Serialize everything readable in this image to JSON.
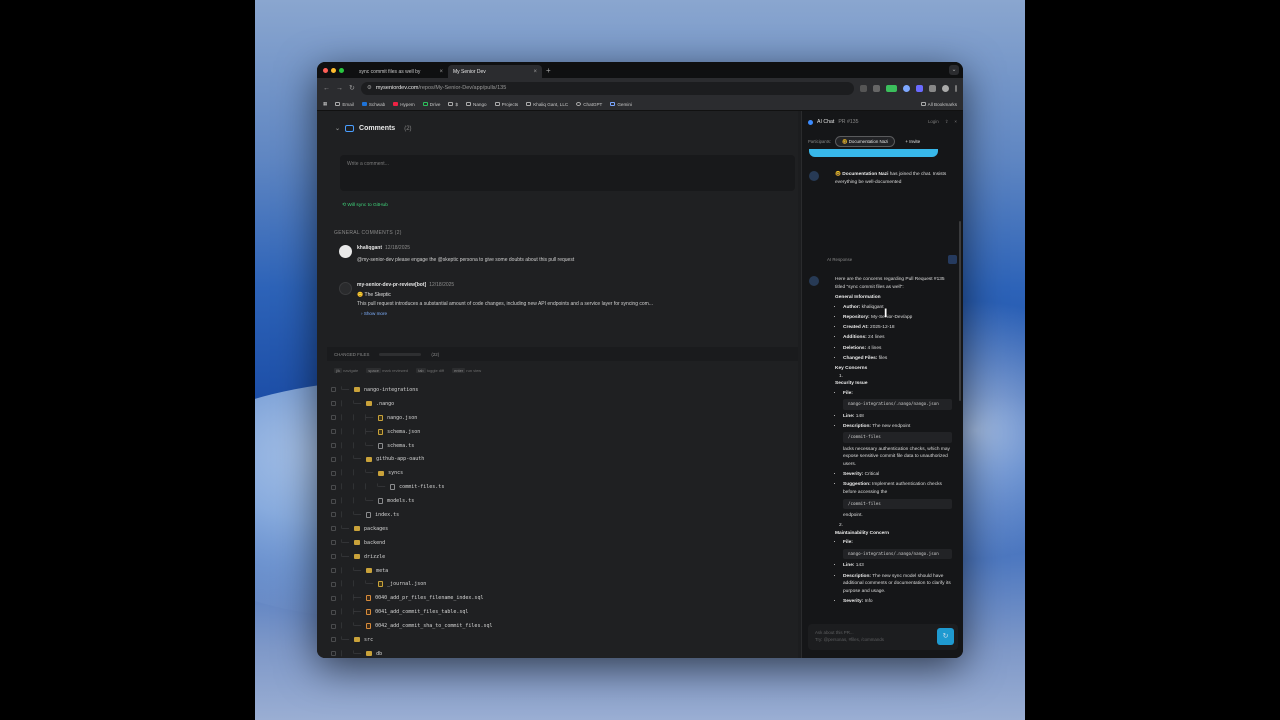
{
  "browser": {
    "tabs": [
      {
        "label": "sync commit files as well by",
        "active": false
      },
      {
        "label": "My Senior Dev",
        "active": true
      }
    ],
    "new_tab": "+",
    "url_host": "myseniordev.com",
    "url_path": "/repos/My-Senior-Dev/app/pulls/135",
    "bookmarks": [
      "Email",
      "Schwab",
      "Hypem",
      "Drive",
      "$",
      "Nango",
      "Projects",
      "Khaliq Gant, LLC",
      "ChatGPT",
      "Gemini"
    ],
    "all_bookmarks": "All Bookmarks"
  },
  "comments": {
    "title": "Comments",
    "count": "(2)",
    "placeholder": "Write a comment...",
    "sync_note": "Will sync to GitHub",
    "general_header": "GENERAL COMMENTS (2)",
    "items": [
      {
        "author": "khaliqgant",
        "date": "12/18/2025",
        "body": "@my-senior-dev please engage the @skeptic persona to give some doubts about this pull request"
      },
      {
        "author": "my-senior-dev-pr-review[bot]",
        "date": "12/18/2025",
        "persona": "😊 The Skeptic",
        "body": "This pull request introduces a substantial amount of code changes, including new API endpoints and a service layer for syncing com...",
        "more": "Show more"
      }
    ]
  },
  "changed_files": {
    "label": "CHANGED FILES",
    "count": "(22)",
    "hints": [
      {
        "key": "j/k",
        "text": "navigate"
      },
      {
        "key": "space",
        "text": "mark reviewed"
      },
      {
        "key": "tab",
        "text": "toggle diff"
      },
      {
        "key": "enter",
        "text": "run view"
      }
    ],
    "tree": [
      {
        "indent": "└── ",
        "name": "nango-integrations",
        "type": "folder"
      },
      {
        "indent": "│   └── ",
        "name": ".nango",
        "type": "folder"
      },
      {
        "indent": "│   │   ├── ",
        "name": "nango.json",
        "type": "json"
      },
      {
        "indent": "│   │   ├── ",
        "name": "schema.json",
        "type": "json"
      },
      {
        "indent": "│   │   └── ",
        "name": "schema.ts",
        "type": "file"
      },
      {
        "indent": "│   └── ",
        "name": "github-app-oauth",
        "type": "folder"
      },
      {
        "indent": "│   │   └── ",
        "name": "syncs",
        "type": "folder"
      },
      {
        "indent": "│   │   │   └── ",
        "name": "commit-files.ts",
        "type": "file"
      },
      {
        "indent": "│   │   └── ",
        "name": "models.ts",
        "type": "file"
      },
      {
        "indent": "│   └── ",
        "name": "index.ts",
        "type": "file"
      },
      {
        "indent": "└── ",
        "name": "packages",
        "type": "folder"
      },
      {
        "indent": "└── ",
        "name": "backend",
        "type": "folder"
      },
      {
        "indent": "└── ",
        "name": "drizzle",
        "type": "folder"
      },
      {
        "indent": "│   └── ",
        "name": "meta",
        "type": "folder"
      },
      {
        "indent": "│   │   └── ",
        "name": "_journal.json",
        "type": "json"
      },
      {
        "indent": "│   ├── ",
        "name": "0040_add_pr_files_filename_index.sql",
        "type": "sql"
      },
      {
        "indent": "│   ├── ",
        "name": "0041_add_commit_files_table.sql",
        "type": "sql"
      },
      {
        "indent": "│   └── ",
        "name": "0042_add_commit_sha_to_commit_files.sql",
        "type": "sql"
      },
      {
        "indent": "└── ",
        "name": "src",
        "type": "folder"
      },
      {
        "indent": "│   └── ",
        "name": "db",
        "type": "folder"
      }
    ]
  },
  "ai_chat": {
    "title": "AI Chat",
    "pr": "PR #135",
    "login": "Login",
    "participants_label": "Participants:",
    "participant": "🤓 Documentation Nazi",
    "invite": "+ Invite",
    "system_message_name": "🤓 Documentation Nazi",
    "system_message_rest": " has joined the chat. Insists everything be well-documented",
    "response_label": "AI Response",
    "intro": "Here are the concerns regarding Pull Request #135 titled \"sync commit files as well\":",
    "general_info_title": "General Information",
    "general_info": [
      {
        "k": "Author:",
        "v": " khaliqgant"
      },
      {
        "k": "Repository:",
        "v": " My-Senior-Dev/app"
      },
      {
        "k": "Created At:",
        "v": " 2025-12-18"
      },
      {
        "k": "Additions:",
        "v": " 24 lines"
      },
      {
        "k": "Deletions:",
        "v": " 4 lines"
      },
      {
        "k": "Changed Files:",
        "v": " files"
      }
    ],
    "key_concerns_title": "Key Concerns",
    "c1_num": "1.",
    "c1_title": "Security Issue",
    "c1_file_label": "File:",
    "c1_file": "nango-integrations/.nango/nango.json",
    "c1_line_label": "Line:",
    "c1_line": " 148",
    "c1_desc_label": "Description:",
    "c1_desc": " The new endpoint",
    "c1_endpoint": "/commit-files",
    "c1_desc2": "lacks necessary authentication checks, which may expose sensitive commit file data to unauthorized users.",
    "c1_sev_label": "Severity:",
    "c1_sev": " Critical",
    "c1_sugg_label": "Suggestion:",
    "c1_sugg": " Implement authentication checks before accessing the",
    "c1_endpoint2": "/commit-files",
    "c1_tail": "endpoint.",
    "c2_num": "2.",
    "c2_title": "Maintainability Concern",
    "c2_file_label": "File:",
    "c2_file": "nango-integrations/.nango/nango.json",
    "c2_line_label": "Line:",
    "c2_line": " 143",
    "c2_desc_label": "Description:",
    "c2_desc": " The new sync model should have additional comments or documentation to clarify its purpose and usage.",
    "c2_sev_label": "Severity:",
    "c2_sev": " Info",
    "input_placeholder_1": "Ask about this PR...",
    "input_placeholder_2": "Try: @personas, #files, /commands"
  }
}
